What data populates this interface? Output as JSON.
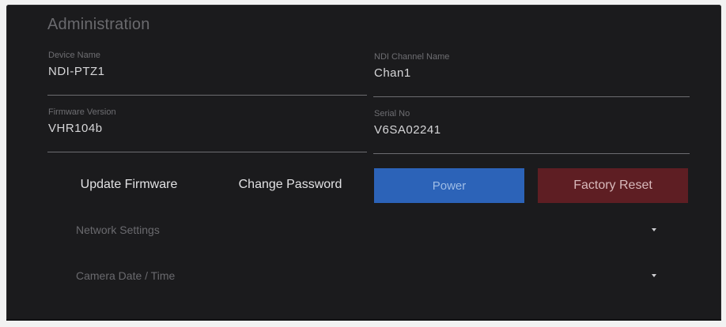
{
  "header": {
    "title": "Administration"
  },
  "fields": {
    "device_name": {
      "label": "Device Name",
      "value": "NDI-PTZ1"
    },
    "ndi_channel": {
      "label": "NDI Channel Name",
      "value": "Chan1"
    },
    "firmware": {
      "label": "Firmware Version",
      "value": "VHR104b"
    },
    "serial": {
      "label": "Serial No",
      "value": "V6SA02241"
    }
  },
  "buttons": {
    "update_firmware": "Update Firmware",
    "change_password": "Change Password",
    "power": "Power",
    "factory_reset": "Factory Reset"
  },
  "sections": {
    "network": {
      "label": "Network Settings",
      "icon": "chevron-down-icon"
    },
    "datetime": {
      "label": "Camera Date / Time",
      "icon": "chevron-down-icon"
    }
  },
  "colors": {
    "panel_bg": "#1b1b1d",
    "power_bg": "#2c63b8",
    "reset_bg": "#5e1e23"
  }
}
